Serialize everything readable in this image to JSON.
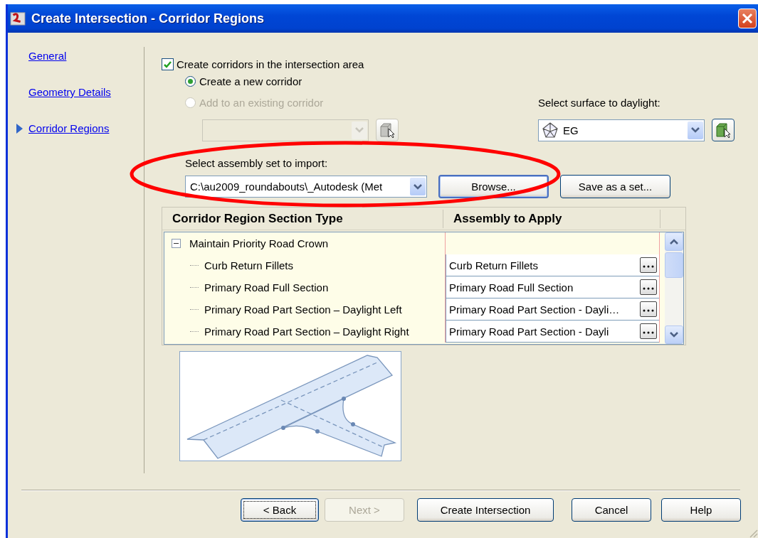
{
  "window": {
    "title": "Create Intersection - Corridor Regions"
  },
  "nav": {
    "items": [
      {
        "label": "General",
        "selected": false
      },
      {
        "label": "Geometry Details",
        "selected": false
      },
      {
        "label": "Corridor Regions",
        "selected": true
      }
    ]
  },
  "create_corridors": {
    "label": "Create corridors in the intersection area",
    "checked": true
  },
  "corridor_options": [
    {
      "label": "Create a new corridor",
      "selected": true,
      "disabled": false
    },
    {
      "label": "Add to an existing corridor",
      "selected": false,
      "disabled": true
    }
  ],
  "existing_corridor": {
    "disabled": true
  },
  "surface": {
    "label": "Select surface to daylight:",
    "value": "EG"
  },
  "assembly_set": {
    "label": "Select assembly set to import:",
    "value": "C:\\au2009_roundabouts\\_Autodesk (Met"
  },
  "assembly_buttons": [
    {
      "label": "Browse...",
      "default": true
    },
    {
      "label": "Save as a set...",
      "default": false
    }
  ],
  "grid": {
    "columns": [
      "Corridor Region Section Type",
      "Assembly to Apply"
    ],
    "rows": [
      {
        "label": "Maintain Priority Road Crown",
        "expanded": true,
        "children": [
          {
            "label": "Curb Return Fillets",
            "assembly": "Curb Return Fillets"
          },
          {
            "label": "Primary Road Full Section",
            "assembly": "Primary Road Full Section"
          },
          {
            "label": "Primary Road Part Section – Daylight Left",
            "assembly": "Primary Road Part Section - Dayli…"
          },
          {
            "label": "Primary Road Part Section – Daylight Right",
            "assembly": "Primary Road Part Section - Dayli"
          }
        ]
      }
    ]
  },
  "annotation": {
    "kind": "ellipse",
    "color": "#ff0000"
  },
  "footer_buttons": [
    {
      "label": "< Back",
      "disabled": false,
      "default": true
    },
    {
      "label": "Next >",
      "disabled": true,
      "default": false
    },
    {
      "label": "Create Intersection",
      "disabled": false,
      "default": false
    },
    {
      "label": "Cancel",
      "disabled": false,
      "default": false
    },
    {
      "label": "Help",
      "disabled": false,
      "default": false
    }
  ]
}
